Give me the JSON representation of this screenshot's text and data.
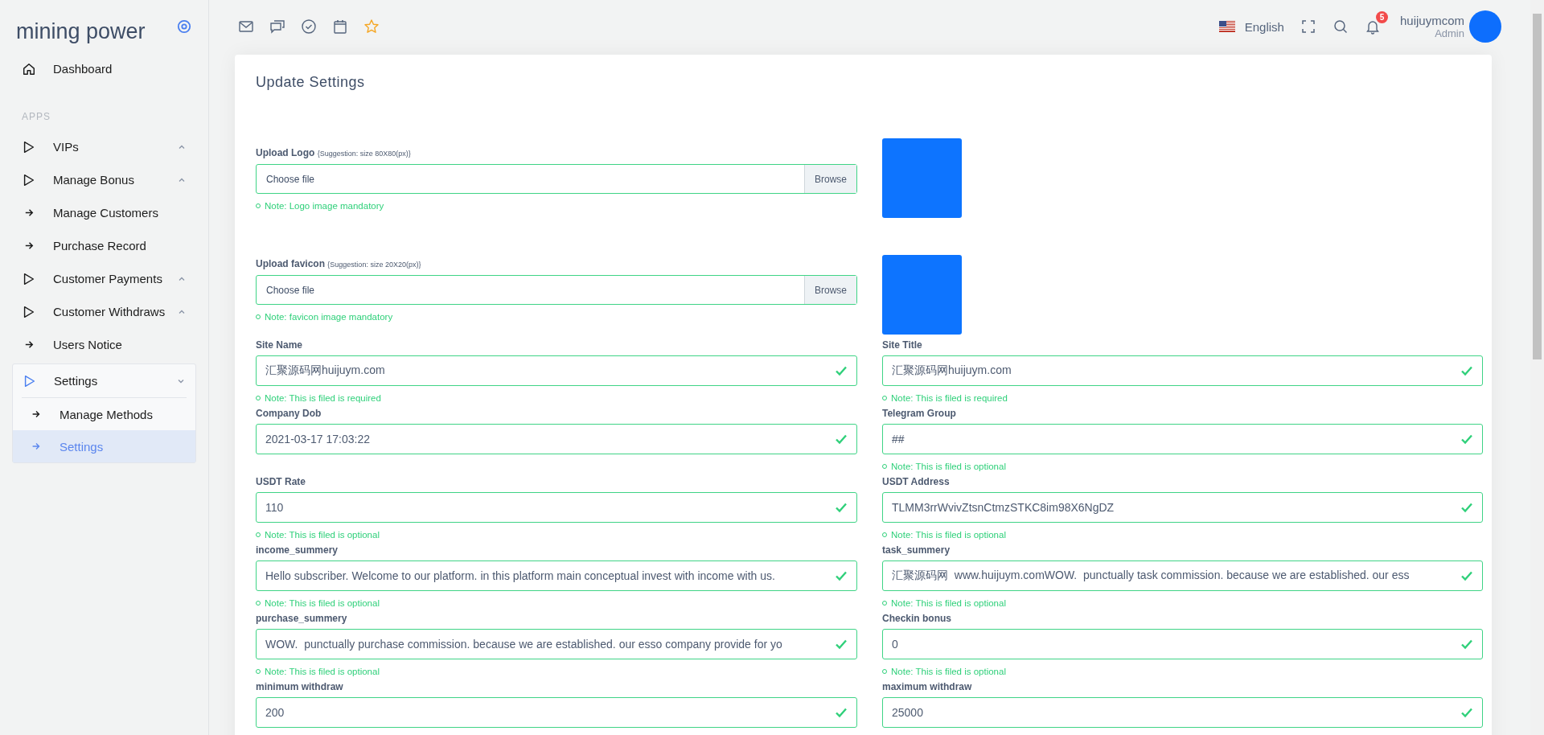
{
  "sidebar": {
    "brand": "mining power",
    "section_label": "APPS",
    "items": [
      {
        "label": "Dashboard",
        "kind": "home",
        "expanded": false,
        "selected": false
      },
      {
        "label": "VIPs",
        "kind": "group",
        "expanded": false,
        "selected": false
      },
      {
        "label": "Manage Bonus",
        "kind": "group",
        "expanded": false,
        "selected": false
      },
      {
        "label": "Manage Customers",
        "kind": "link",
        "expanded": false,
        "selected": false
      },
      {
        "label": "Purchase Record",
        "kind": "link",
        "expanded": false,
        "selected": false
      },
      {
        "label": "Customer Payments",
        "kind": "group",
        "expanded": false,
        "selected": false
      },
      {
        "label": "Customer Withdraws",
        "kind": "group",
        "expanded": false,
        "selected": false
      },
      {
        "label": "Users Notice",
        "kind": "link",
        "expanded": false,
        "selected": false
      },
      {
        "label": "Settings",
        "kind": "group",
        "expanded": true,
        "selected": true,
        "children": [
          {
            "label": "Manage Methods",
            "selected": false
          },
          {
            "label": "Settings",
            "selected": true
          }
        ]
      }
    ]
  },
  "topbar": {
    "language": "English",
    "notification_count": "5",
    "user_name": "huijuymcom",
    "user_role": "Admin"
  },
  "card": {
    "title": "Update Settings",
    "uploads": [
      {
        "label": "Upload Logo",
        "hint": "{Suggestion: size 80X80(px)}",
        "placeholder": "Choose file",
        "button": "Browse",
        "note": "Note: Logo image mandatory"
      },
      {
        "label": "Upload favicon",
        "hint": "{Suggestion: size 20X20(px)}",
        "placeholder": "Choose file",
        "button": "Browse",
        "note": "Note: favicon image mandatory"
      }
    ],
    "field_rows": [
      [
        {
          "label": "Site Name",
          "value": "汇聚源码网huijuym.com",
          "valid": true,
          "note": "Note: This is filed is required"
        },
        {
          "label": "Site Title",
          "value": "汇聚源码网huijuym.com",
          "valid": true,
          "note": "Note: This is filed is required"
        }
      ],
      [
        {
          "label": "Company Dob",
          "value": "2021-03-17 17:03:22",
          "valid": true
        },
        {
          "label": "Telegram Group",
          "value": "##",
          "valid": true,
          "note": "Note: This is filed is optional"
        }
      ],
      [
        {
          "label": "USDT Rate",
          "value": "110",
          "valid": true,
          "note": "Note: This is filed is optional"
        },
        {
          "label": "USDT Address",
          "value": "TLMM3rrWvivZtsnCtmzSTKC8im98X6NgDZ",
          "valid": true,
          "note": "Note: This is filed is optional"
        }
      ],
      [
        {
          "label": "income_summery",
          "value": "Hello subscriber. Welcome to our platform. in this platform main conceptual invest with income with us.",
          "valid": true,
          "note": "Note: This is filed is optional"
        },
        {
          "label": "task_summery",
          "value": "汇聚源码网  www.huijuym.comWOW.  punctually task commission. because we are established. our ess",
          "valid": true,
          "note": "Note: This is filed is optional"
        }
      ],
      [
        {
          "label": "purchase_summery",
          "value": "WOW.  punctually purchase commission. because we are established. our esso company provide for yo",
          "valid": true,
          "note": "Note: This is filed is optional"
        },
        {
          "label": "Checkin bonus",
          "value": "0",
          "valid": true,
          "note": "Note: This is filed is optional"
        }
      ],
      [
        {
          "label": "minimum withdraw",
          "value": "200",
          "valid": true
        },
        {
          "label": "maximum withdraw",
          "value": "25000",
          "valid": true
        }
      ]
    ]
  }
}
